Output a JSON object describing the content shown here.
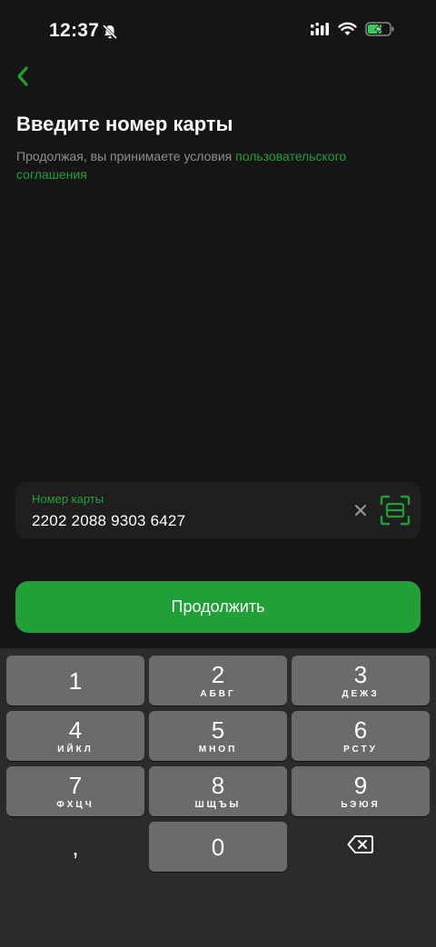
{
  "status_bar": {
    "time": "12:37",
    "battery_color": "#30d158"
  },
  "header": {
    "back_icon": "chevron-left-icon",
    "title": "Введите номер карты",
    "terms_text": "Продолжая, вы принимаете условия ",
    "terms_link": "пользовательского соглашения"
  },
  "card_field": {
    "label": "Номер карты",
    "value": "2202 2088 9303 6427",
    "clear_icon": "close-icon",
    "scan_icon": "card-scan-icon"
  },
  "continue_button": {
    "label": "Продолжить"
  },
  "colors": {
    "accent": "#21a038",
    "background": "#151515",
    "key": "#6b6b6b"
  },
  "keyboard": {
    "keys": [
      {
        "digit": "1",
        "letters": ""
      },
      {
        "digit": "2",
        "letters": "АБВГ"
      },
      {
        "digit": "3",
        "letters": "ДЕЖЗ"
      },
      {
        "digit": "4",
        "letters": "ИЙКЛ"
      },
      {
        "digit": "5",
        "letters": "МНОП"
      },
      {
        "digit": "6",
        "letters": "РСТУ"
      },
      {
        "digit": "7",
        "letters": "ФХЦЧ"
      },
      {
        "digit": "8",
        "letters": "ШЩЪЫ"
      },
      {
        "digit": "9",
        "letters": "ЬЭЮЯ"
      }
    ],
    "comma": ",",
    "zero": "0",
    "delete_icon": "backspace-icon"
  }
}
